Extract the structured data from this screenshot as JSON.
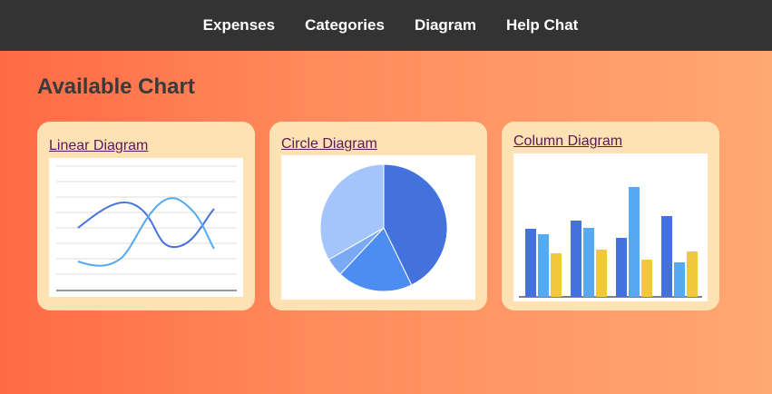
{
  "nav": {
    "items": [
      "Expenses",
      "Categories",
      "Diagram",
      "Help Chat"
    ]
  },
  "page": {
    "title": "Available Chart"
  },
  "cards": [
    {
      "label": "Linear Diagram",
      "icon": "line-chart-thumbnail"
    },
    {
      "label": "Circle Diagram",
      "icon": "pie-chart-thumbnail"
    },
    {
      "label": "Column Diagram",
      "icon": "column-chart-thumbnail"
    }
  ],
  "colors": {
    "navbar": "#333333",
    "card_bg": "#ffe2b3",
    "link": "#5b1a57",
    "chart_blue_dark": "#4472dd",
    "chart_blue_light": "#55aaf2",
    "chart_yellow": "#f0c83c"
  }
}
